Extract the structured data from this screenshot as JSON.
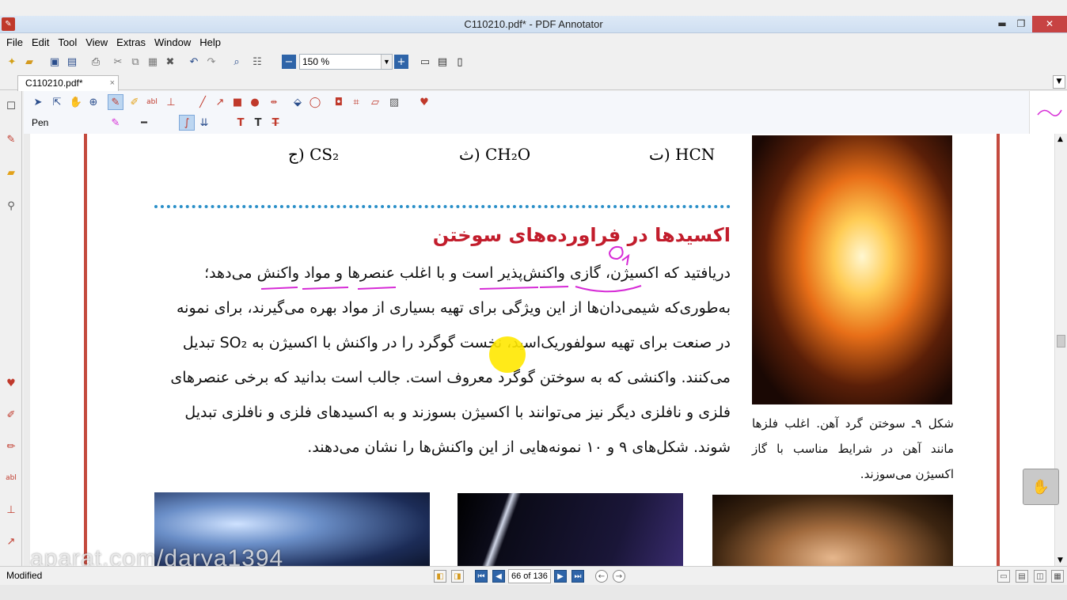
{
  "window": {
    "title": "C110210.pdf* - PDF Annotator",
    "minimize": "▬",
    "maximize": "❐",
    "close": "✕"
  },
  "menu": [
    {
      "label": "File"
    },
    {
      "label": "Edit"
    },
    {
      "label": "Tool"
    },
    {
      "label": "View"
    },
    {
      "label": "Extras"
    },
    {
      "label": "Window"
    },
    {
      "label": "Help"
    }
  ],
  "toolbar": {
    "zoom_value": "150 %"
  },
  "tab": {
    "label": "C110210.pdf*",
    "close": "×"
  },
  "toolpanel": {
    "current_tool": "Pen"
  },
  "document": {
    "formulas": {
      "f1": "HCN (ت",
      "f2": "CH₂O (ث",
      "f3": "CS₂ (ج"
    },
    "heading": "اکسیدها در فراورده‌های سوختن",
    "paragraph_lines": [
      "دریافتید که اکسیژن، گازی واکنش‌پذیر است و با اغلب عنصرها و مواد واکنش می‌دهد؛",
      "به‌طوری‌که شیمی‌دان‌ها از این ویژگی برای تهیه بسیاری از مواد بهره می‌گیرند، برای نمونه",
      "در صنعت برای تهیه سولفوریک‌اسید، نخست گوگرد را در واکنش با اکسیژن به SO₂ تبدیل",
      "می‌کنند. واکنشی که به سوختن گوگرد معروف است. جالب است بدانید که برخی عنصرهای",
      "فلزی و نافلزی دیگر نیز می‌توانند با اکسیژن بسوزند و به اکسیدهای فلزی و نافلزی تبدیل",
      "شوند. شکل‌های ۹ و ۱۰ نمونه‌هایی از این واکنش‌ها را نشان می‌دهند."
    ],
    "caption": "شکل ۹ـ سوختن گرد آهن. اغلب فلزها مانند آهن در شرایط مناسب با گاز اکسیژن می‌سوزند.",
    "watermark": "aparat.com/darya1394"
  },
  "statusbar": {
    "status": "Modified",
    "page_indicator": "66 of 136"
  },
  "colors": {
    "heading": "#c21d2c",
    "page_border": "#c44a3e",
    "dotted_line": "#2a8fc8",
    "annotation_pen": "#d62bd6"
  }
}
